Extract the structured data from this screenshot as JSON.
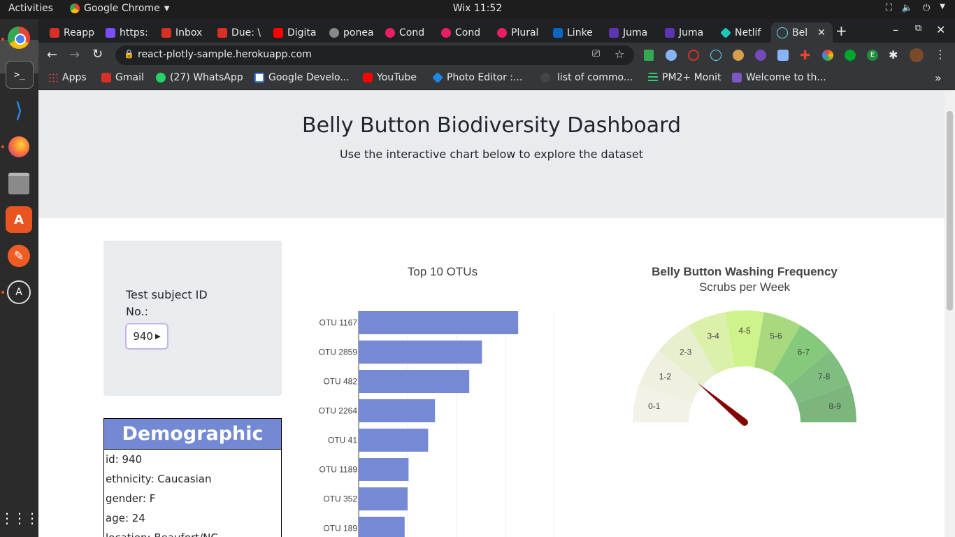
{
  "system": {
    "activities": "Activities",
    "app_name": "Google Chrome",
    "clock": "Wix 11:52"
  },
  "tabs": [
    {
      "label": "Reapp",
      "color": "#d93025"
    },
    {
      "label": "https:",
      "color": "#7c4dff"
    },
    {
      "label": "Inbox",
      "color": "#d93025"
    },
    {
      "label": "Due: \\",
      "color": "#d93025"
    },
    {
      "label": "Digita",
      "color": "#ff0000"
    },
    {
      "label": "ponea",
      "color": "#888888"
    },
    {
      "label": "Cond",
      "color": "#e91e63"
    },
    {
      "label": "Cond",
      "color": "#e91e63"
    },
    {
      "label": "Plural",
      "color": "#e91e63"
    },
    {
      "label": "Linke",
      "color": "#0a66c2"
    },
    {
      "label": "Juma",
      "color": "#5e35b1"
    },
    {
      "label": "Juma",
      "color": "#5e35b1"
    },
    {
      "label": "Netlif",
      "color": "#20c6b7"
    },
    {
      "label": "Bel",
      "color": "#61dafb",
      "active": true
    }
  ],
  "address_bar": {
    "url": "react-plotly-sample.herokuapp.com"
  },
  "bookmarks": [
    {
      "label": "Apps",
      "color": "#ea4335"
    },
    {
      "label": "Gmail",
      "color": "#d93025"
    },
    {
      "label": "(27) WhatsApp",
      "color": "#25d366"
    },
    {
      "label": "Google Develo...",
      "color": "#4285f4"
    },
    {
      "label": "YouTube",
      "color": "#ff0000"
    },
    {
      "label": "Photo Editor :...",
      "color": "#1e88e5"
    },
    {
      "label": "list of commo...",
      "color": "#444444"
    },
    {
      "label": "PM2+ Monit",
      "color": "#2ecc71"
    },
    {
      "label": "Welcome to th...",
      "color": "#7e57c2"
    }
  ],
  "page": {
    "title": "Belly Button Biodiversity Dashboard",
    "subtitle": "Use the interactive chart below to explore the dataset",
    "select_label": "Test subject ID No.:",
    "selected_id": "940",
    "demographic_title": "Demographic Info",
    "demographics": [
      "id: 940",
      "ethnicity: Caucasian",
      "gender: F",
      "age: 24",
      "location: Beaufort/NC"
    ]
  },
  "chart_data": [
    {
      "type": "bar",
      "orientation": "horizontal",
      "title": "Top 10 OTUs",
      "categories": [
        "OTU 1167",
        "OTU 2859",
        "OTU 482",
        "OTU 2264",
        "OTU 41",
        "OTU 1189",
        "OTU 352",
        "OTU 189"
      ],
      "values": [
        163,
        126,
        113,
        78,
        71,
        51,
        50,
        47
      ],
      "color": "#7589d4",
      "grid": true
    },
    {
      "type": "gauge",
      "title": "Belly Button Washing Frequency",
      "subtitle": "Scrubs per Week",
      "range": [
        0,
        9
      ],
      "value": 2,
      "categories": [
        "0-1",
        "1-2",
        "2-3",
        "3-4",
        "4-5",
        "5-6",
        "6-7",
        "7-8",
        "8-9"
      ],
      "colors": [
        "#f4f1e6",
        "#eff0e0",
        "#e6efce",
        "#dbf0ab",
        "#cdf38a",
        "#a8d97f",
        "#85c97a",
        "#7fbd81",
        "#7cb67d"
      ],
      "needle_color": "#850000"
    }
  ]
}
